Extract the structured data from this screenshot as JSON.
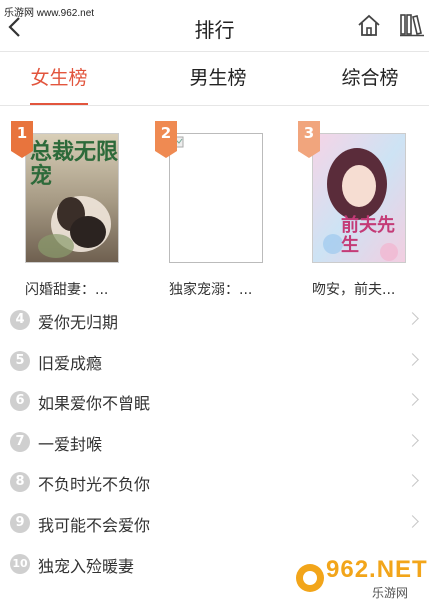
{
  "watermark_top": "乐游网 www.962.net",
  "header": {
    "title": "排行"
  },
  "tabs": [
    {
      "label": "女生榜",
      "active": true
    },
    {
      "label": "男生榜",
      "active": false
    },
    {
      "label": "综合榜",
      "active": false
    }
  ],
  "top_books": [
    {
      "rank": "1",
      "title": "闪婚甜妻：...",
      "cover_text": "总裁无限宠"
    },
    {
      "rank": "2",
      "title": "独家宠溺：..."
    },
    {
      "rank": "3",
      "title": "吻安，前夫...",
      "cover_text": "前夫先生"
    }
  ],
  "ranked_list": [
    {
      "rank": "4",
      "title": "爱你无归期"
    },
    {
      "rank": "5",
      "title": "旧爱成瘾"
    },
    {
      "rank": "6",
      "title": "如果爱你不曾眠"
    },
    {
      "rank": "7",
      "title": "一爱封喉"
    },
    {
      "rank": "8",
      "title": "不负时光不负你"
    },
    {
      "rank": "9",
      "title": "我可能不会爱你"
    },
    {
      "rank": "10",
      "title": "独宠入殓暖妻"
    }
  ],
  "logo_watermark": {
    "brand": "962.NET",
    "sub": "乐游网"
  },
  "colors": {
    "accent": "#e2553d",
    "badge1": "#e8743d",
    "badge2": "#ef8a52",
    "badge3": "#f1a57d"
  }
}
